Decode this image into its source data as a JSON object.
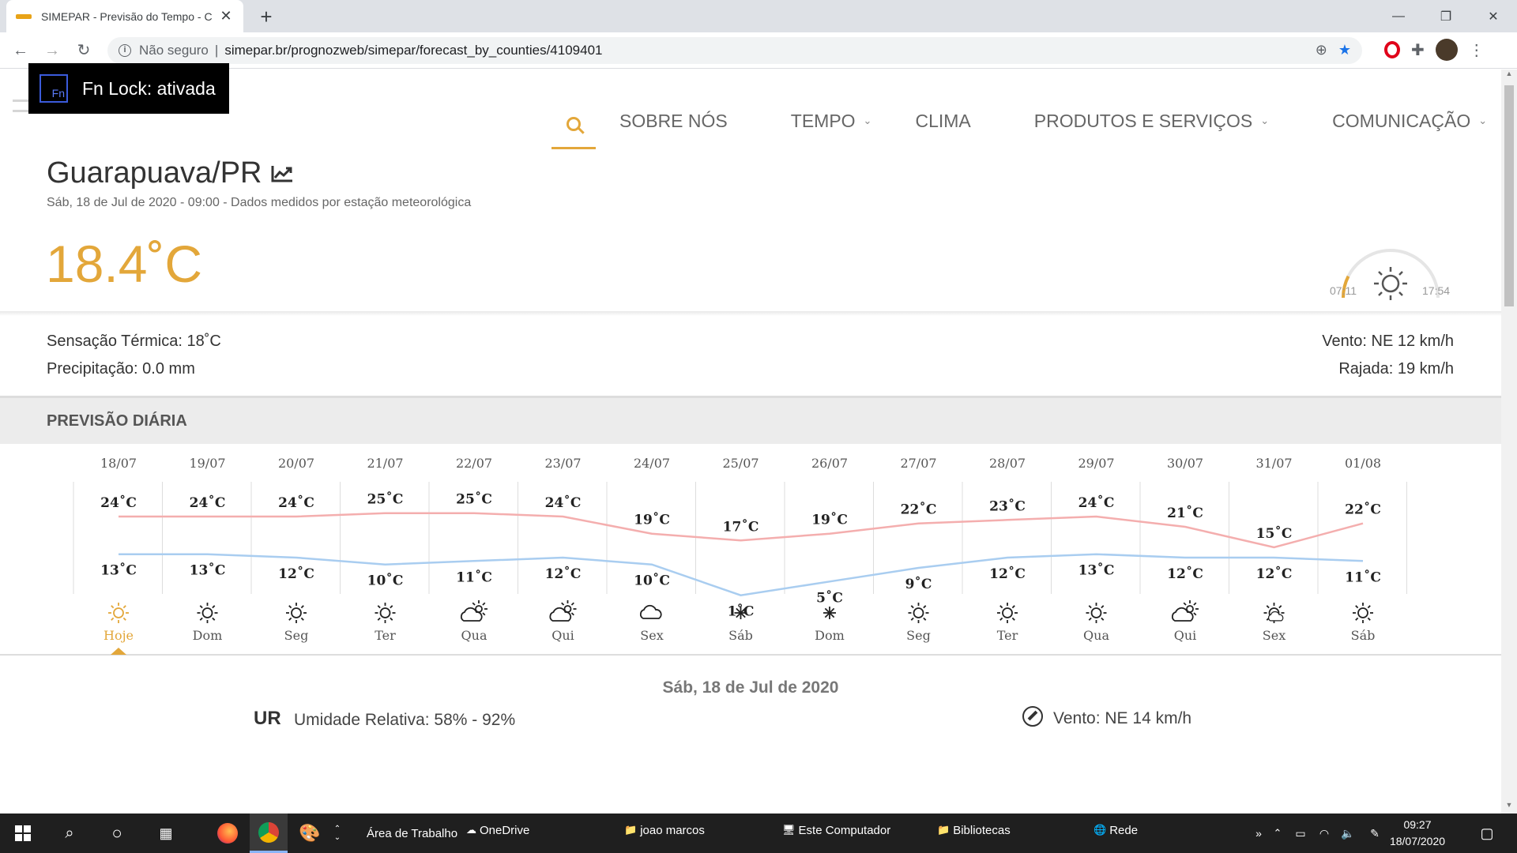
{
  "browser": {
    "tab_title": "SIMEPAR - Previsão do Tempo - C",
    "insecure_label": "Não seguro",
    "url": "simepar.br/prognozweb/simepar/forecast_by_counties/4109401"
  },
  "fnlock": {
    "icon_text": "Fn",
    "text": "Fn Lock: ativada"
  },
  "nav": {
    "items": [
      {
        "label": "SOBRE NÓS",
        "chevron": false
      },
      {
        "label": "TEMPO",
        "chevron": true
      },
      {
        "label": "CLIMA",
        "chevron": false
      },
      {
        "label": "PRODUTOS E SERVIÇOS",
        "chevron": true
      },
      {
        "label": "COMUNICAÇÃO",
        "chevron": true
      }
    ]
  },
  "current": {
    "city": "Guarapuava/PR",
    "subtitle": "Sáb, 18 de Jul de 2020 - 09:00 - Dados medidos por estação meteorológica",
    "temperature": "18.4˚C",
    "sunrise": "07:11",
    "sunset": "17:54",
    "feels_like": "Sensação Térmica: 18˚C",
    "precipitation": "Precipitação: 0.0 mm",
    "wind": "Vento: NE 12 km/h",
    "gust": "Rajada: 19 km/h",
    "day_progress": 0.15
  },
  "daily": {
    "title": "PREVISÃO DIÁRIA",
    "colors": {
      "max": "#f4aeae",
      "min": "#a9cdf0",
      "accent": "#e3a73a"
    }
  },
  "chart_data": {
    "type": "line",
    "categories": [
      "18/07",
      "19/07",
      "20/07",
      "21/07",
      "22/07",
      "23/07",
      "24/07",
      "25/07",
      "26/07",
      "27/07",
      "28/07",
      "29/07",
      "30/07",
      "31/07",
      "01/08"
    ],
    "weekdays": [
      "Hoje",
      "Dom",
      "Seg",
      "Ter",
      "Qua",
      "Qui",
      "Sex",
      "Sáb",
      "Dom",
      "Seg",
      "Ter",
      "Qua",
      "Qui",
      "Sex",
      "Sáb"
    ],
    "icons": [
      "sun-icon",
      "sun-icon",
      "sun-icon",
      "sun-icon",
      "partly-cloudy-icon",
      "partly-cloudy-icon",
      "cloud-icon",
      "frost-icon",
      "frost-icon",
      "sun-icon",
      "sun-icon",
      "sun-icon",
      "partly-cloudy-icon",
      "partly-sunny-icon",
      "sun-icon"
    ],
    "series": [
      {
        "values": [
          24,
          24,
          24,
          25,
          25,
          24,
          19,
          17,
          19,
          22,
          23,
          24,
          21,
          15,
          22
        ]
      },
      {
        "values": [
          13,
          13,
          12,
          10,
          11,
          12,
          10,
          1,
          5,
          9,
          12,
          13,
          12,
          12,
          11
        ]
      }
    ],
    "unit": "˚C",
    "ylim": [
      0,
      30
    ],
    "grid": false
  },
  "detail": {
    "date_heading": "Sáb, 18 de Jul de 2020",
    "ur_label": "UR",
    "humidity": "Umidade Relativa: 58% - 92%",
    "wind": "Vento: NE 14 km/h"
  },
  "taskbar": {
    "toolbar_label": "Área de Trabalho",
    "links": [
      "OneDrive",
      "joao marcos",
      "Este Computador",
      "Bibliotecas",
      "Rede"
    ],
    "time": "09:27",
    "date": "18/07/2020"
  }
}
